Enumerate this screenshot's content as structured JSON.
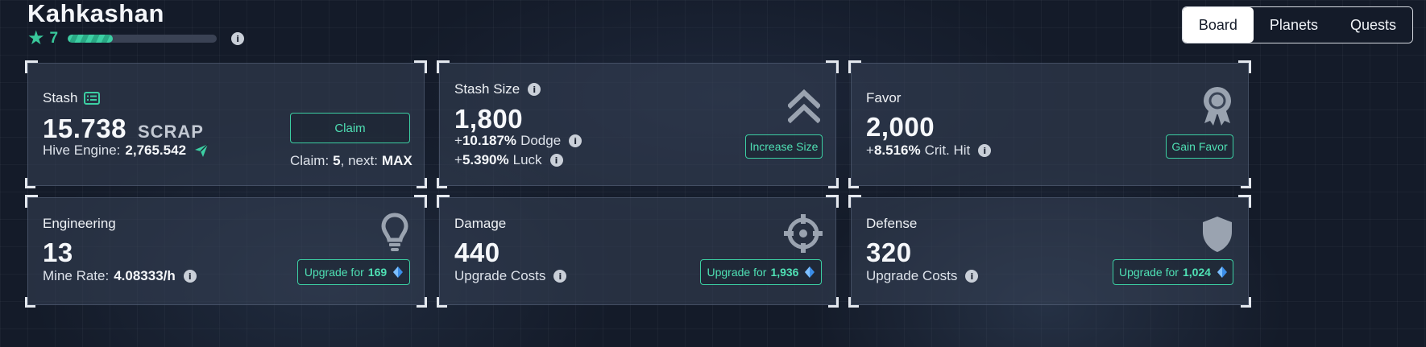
{
  "header": {
    "title": "Kahkashan",
    "level": "7",
    "xp_fraction": 0.3
  },
  "tabs": [
    {
      "label": "Board",
      "active": true
    },
    {
      "label": "Planets",
      "active": false
    },
    {
      "label": "Quests",
      "active": false
    }
  ],
  "stash": {
    "label": "Stash",
    "amount": "15.738",
    "unit": "SCRAP",
    "hive_label": "Hive Engine:",
    "hive_value": "2,765.542",
    "claim_button": "Claim",
    "claim_info_label": "Claim:",
    "claim_count": "5",
    "next_label": ", next:",
    "next_value": "MAX"
  },
  "stash_size": {
    "label": "Stash Size",
    "value": "1,800",
    "dodge_prefix": "+",
    "dodge_value": "10.187%",
    "dodge_label": "Dodge",
    "luck_prefix": "+",
    "luck_value": "5.390%",
    "luck_label": "Luck",
    "button": "Increase Size"
  },
  "favor": {
    "label": "Favor",
    "value": "2,000",
    "crit_prefix": "+",
    "crit_value": "8.516%",
    "crit_label": "Crit. Hit",
    "button": "Gain Favor"
  },
  "engineering": {
    "label": "Engineering",
    "value": "13",
    "rate_label": "Mine Rate:",
    "rate_value": "4.08333/h",
    "button_prefix": "Upgrade for",
    "button_cost": "169"
  },
  "damage": {
    "label": "Damage",
    "value": "440",
    "costs_label": "Upgrade Costs",
    "button_prefix": "Upgrade for",
    "button_cost": "1,936"
  },
  "defense": {
    "label": "Defense",
    "value": "320",
    "costs_label": "Upgrade Costs",
    "button_prefix": "Upgrade for",
    "button_cost": "1,024"
  },
  "icons": {
    "star": "star-icon",
    "info": "info-icon",
    "list": "list-icon",
    "send": "paper-plane-icon",
    "chevrons": "double-chevron-up-icon",
    "award": "award-badge-icon",
    "bulb": "lightbulb-icon",
    "crosshair": "crosshair-icon",
    "shield": "shield-icon",
    "gem": "crystal-gem-icon"
  },
  "colors": {
    "accent": "#3ccfa3",
    "background": "#141b29"
  }
}
